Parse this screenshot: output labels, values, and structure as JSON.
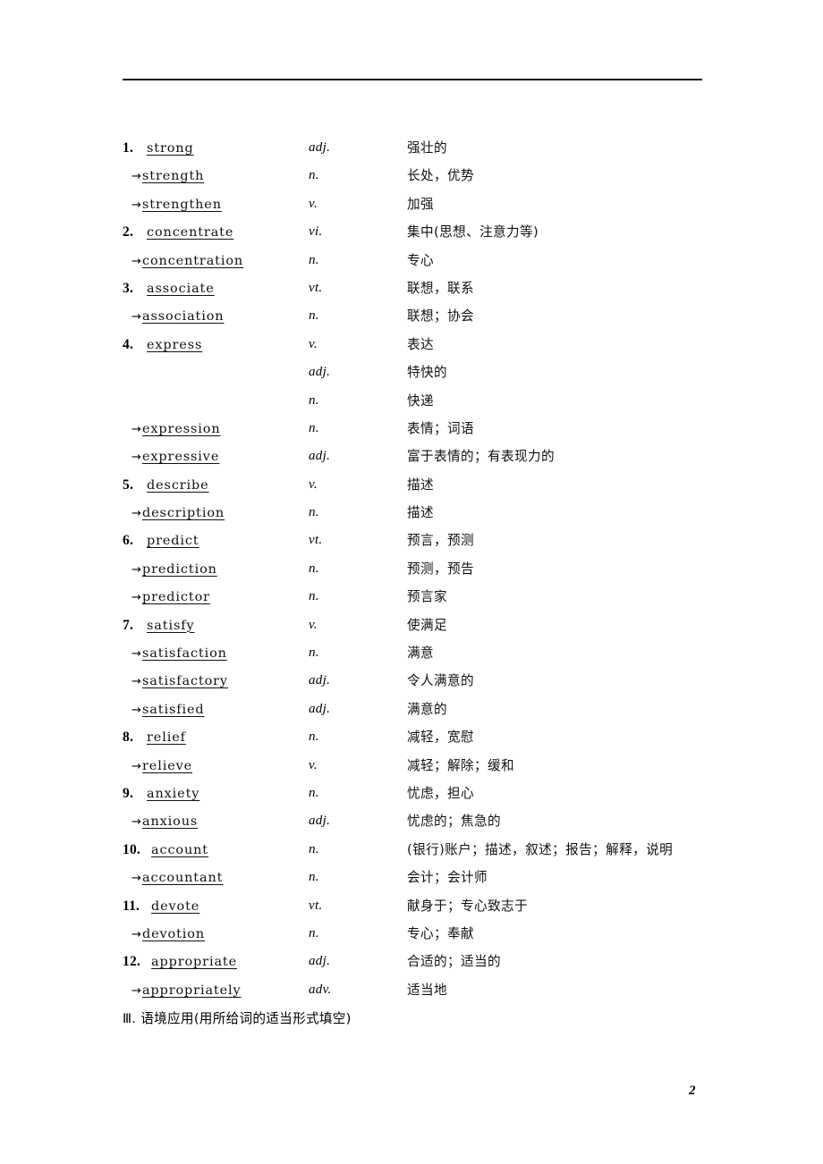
{
  "page": {
    "number": "2",
    "footer_heading": "Ⅲ. 语境应用(用所给词的适当形式填空)",
    "rule_color": "#0a0a0a"
  },
  "word_list": {
    "rows": [
      {
        "marker": "1.",
        "marker_type": "number",
        "word": "strong",
        "pos": "adj.",
        "definition": "强壮的"
      },
      {
        "marker": "→",
        "marker_type": "arrow",
        "word": "strength",
        "pos": "n.",
        "definition": "长处，优势"
      },
      {
        "marker": "→",
        "marker_type": "arrow",
        "word": "strengthen",
        "pos": "v.",
        "definition": "加强"
      },
      {
        "marker": "2.",
        "marker_type": "number",
        "word": "concentrate",
        "pos": "vi.",
        "definition": "集中(思想、注意力等)"
      },
      {
        "marker": "→",
        "marker_type": "arrow",
        "word": "concentration",
        "pos": "n.",
        "definition": "专心"
      },
      {
        "marker": "3.",
        "marker_type": "number",
        "word": "associate",
        "pos": "vt.",
        "definition": "联想，联系"
      },
      {
        "marker": "→",
        "marker_type": "arrow",
        "word": "association",
        "pos": "n.",
        "definition": "联想；协会"
      },
      {
        "marker": "4.",
        "marker_type": "number",
        "word": "express",
        "pos": "v.",
        "definition": "表达"
      },
      {
        "marker": "",
        "marker_type": "none",
        "word": "",
        "pos": "adj.",
        "definition": "特快的"
      },
      {
        "marker": "",
        "marker_type": "none",
        "word": "",
        "pos": "n.",
        "definition": "快递"
      },
      {
        "marker": "→",
        "marker_type": "arrow",
        "word": "expression",
        "pos": "n.",
        "definition": "表情；词语"
      },
      {
        "marker": "→",
        "marker_type": "arrow",
        "word": "expressive",
        "pos": "adj.",
        "definition": "富于表情的；有表现力的"
      },
      {
        "marker": "5.",
        "marker_type": "number",
        "word": "describe",
        "pos": "v.",
        "definition": "描述"
      },
      {
        "marker": "→",
        "marker_type": "arrow",
        "word": "description",
        "pos": "n.",
        "definition": "描述"
      },
      {
        "marker": "6.",
        "marker_type": "number",
        "word": "predict",
        "pos": "vt.",
        "definition": "预言，预测"
      },
      {
        "marker": "→",
        "marker_type": "arrow",
        "word": "prediction",
        "pos": "n.",
        "definition": "预测，预告"
      },
      {
        "marker": "→",
        "marker_type": "arrow",
        "word": "predictor",
        "pos": "n.",
        "definition": "预言家"
      },
      {
        "marker": "7.",
        "marker_type": "number",
        "word": "satisfy",
        "pos": "v.",
        "definition": "使满足"
      },
      {
        "marker": "→",
        "marker_type": "arrow",
        "word": "satisfaction",
        "pos": "n.",
        "definition": "满意"
      },
      {
        "marker": "→",
        "marker_type": "arrow",
        "word": "satisfactory",
        "pos": "adj.",
        "definition": "令人满意的"
      },
      {
        "marker": "→",
        "marker_type": "arrow",
        "word": "satisfied",
        "pos": "adj.",
        "definition": "满意的"
      },
      {
        "marker": "8.",
        "marker_type": "number",
        "word": "relief",
        "pos": "n.",
        "definition": "减轻，宽慰"
      },
      {
        "marker": "→",
        "marker_type": "arrow",
        "word": "relieve",
        "pos": "v.",
        "definition": "减轻；解除；缓和"
      },
      {
        "marker": "9.",
        "marker_type": "number",
        "word": "anxiety",
        "pos": "n.",
        "definition": "忧虑，担心"
      },
      {
        "marker": "→",
        "marker_type": "arrow",
        "word": "anxious",
        "pos": "adj.",
        "definition": "忧虑的；焦急的"
      },
      {
        "marker": "10.",
        "marker_type": "number",
        "word": "account",
        "pos": "n.",
        "definition": "(银行)账户；描述，叙述；报告；解释，说明"
      },
      {
        "marker": "→",
        "marker_type": "arrow",
        "word": "accountant",
        "pos": "n.",
        "definition": "会计；会计师"
      },
      {
        "marker": "11.",
        "marker_type": "number",
        "word": "devote",
        "pos": "vt.",
        "definition": "献身于；专心致志于"
      },
      {
        "marker": "→",
        "marker_type": "arrow",
        "word": "devotion",
        "pos": "n.",
        "definition": "专心；奉献"
      },
      {
        "marker": "12.",
        "marker_type": "number",
        "word": "appropriate",
        "pos": "adj.",
        "definition": "合适的；适当的"
      },
      {
        "marker": "→",
        "marker_type": "arrow",
        "word": "appropriately",
        "pos": "adv.",
        "definition": "适当地"
      }
    ]
  }
}
